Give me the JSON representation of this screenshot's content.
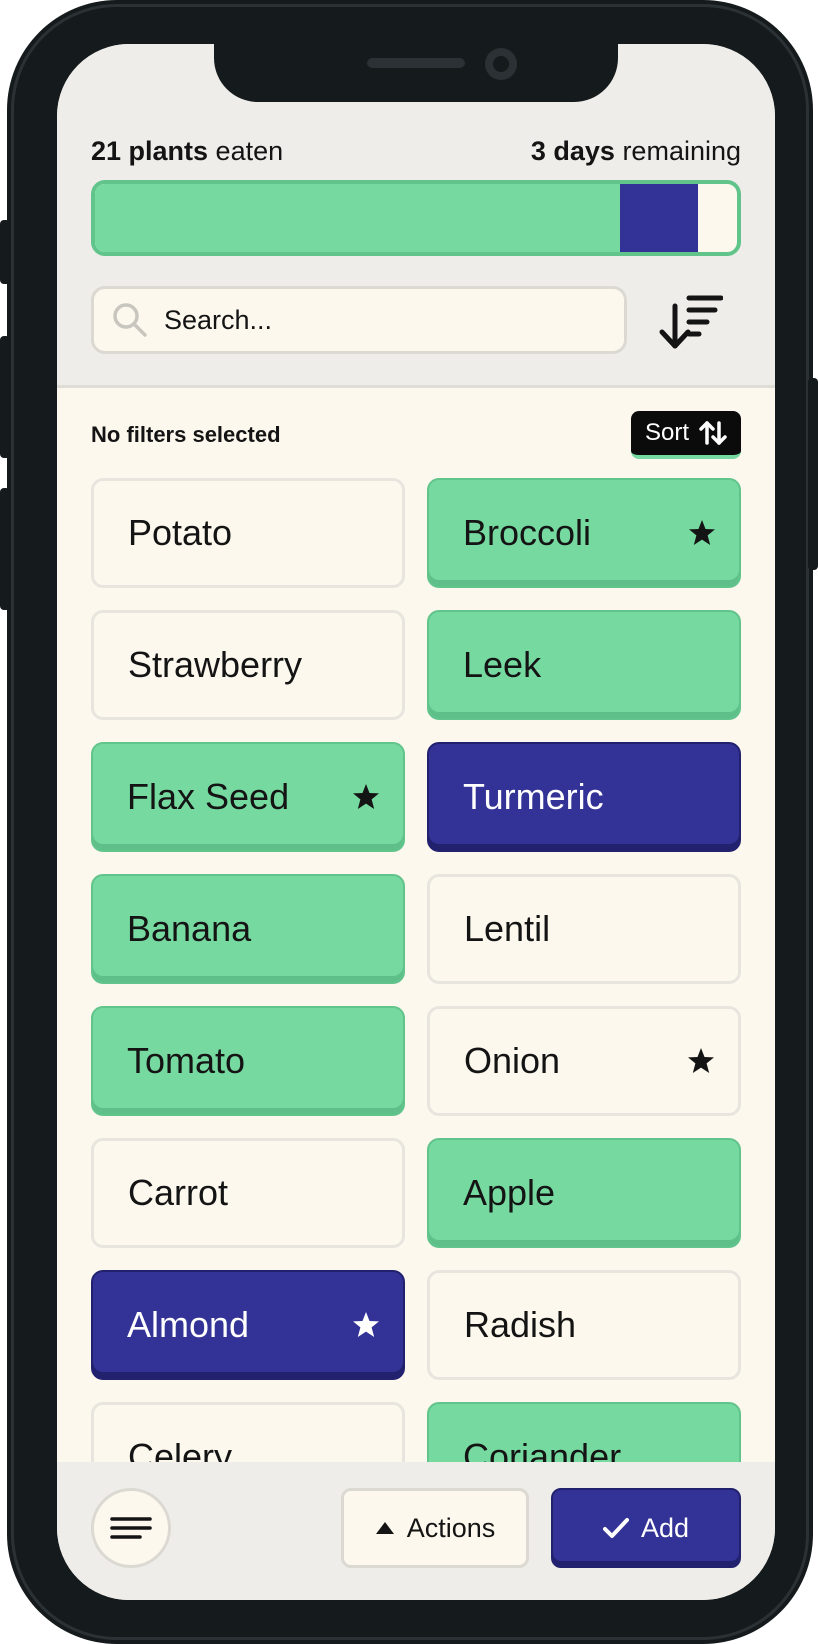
{
  "stats": {
    "plants_count": "21 plants",
    "plants_suffix": " eaten",
    "days_count": "3 days",
    "days_suffix": " remaining"
  },
  "progress": {
    "green_fraction": 0.817,
    "blue_fraction": 0.123,
    "colors": {
      "green": "#75d9a0",
      "blue": "#333297",
      "empty": "#fcf8ee"
    }
  },
  "search": {
    "placeholder": "Search...",
    "value": ""
  },
  "filter": {
    "label": "No filters selected",
    "sort_label": "Sort"
  },
  "icons": {
    "search": "search-icon",
    "sort_desc": "sort-descending-icon",
    "sort_arrows": "sort-arrows-icon",
    "star": "star-icon",
    "menu": "menu-icon",
    "caret_up": "caret-up-icon",
    "check": "check-icon"
  },
  "plants": [
    {
      "name": "Potato",
      "state": "plain",
      "starred": false
    },
    {
      "name": "Broccoli",
      "state": "green",
      "starred": true
    },
    {
      "name": "Strawberry",
      "state": "plain",
      "starred": false
    },
    {
      "name": "Leek",
      "state": "green",
      "starred": false
    },
    {
      "name": "Flax Seed",
      "state": "green",
      "starred": true
    },
    {
      "name": "Turmeric",
      "state": "blue",
      "starred": false
    },
    {
      "name": "Banana",
      "state": "green",
      "starred": false
    },
    {
      "name": "Lentil",
      "state": "plain",
      "starred": false
    },
    {
      "name": "Tomato",
      "state": "green",
      "starred": false
    },
    {
      "name": "Onion",
      "state": "plain",
      "starred": true
    },
    {
      "name": "Carrot",
      "state": "plain",
      "starred": false
    },
    {
      "name": "Apple",
      "state": "green",
      "starred": false
    },
    {
      "name": "Almond",
      "state": "blue",
      "starred": true
    },
    {
      "name": "Radish",
      "state": "plain",
      "starred": false
    },
    {
      "name": "Celery",
      "state": "plain",
      "starred": false
    },
    {
      "name": "Coriander",
      "state": "green",
      "starred": false
    }
  ],
  "bottom": {
    "actions_label": "Actions",
    "add_label": "Add"
  },
  "colors": {
    "accent_green": "#75d9a0",
    "accent_blue": "#333297",
    "background": "#fcf8ee",
    "header_bg": "#eeede9"
  }
}
